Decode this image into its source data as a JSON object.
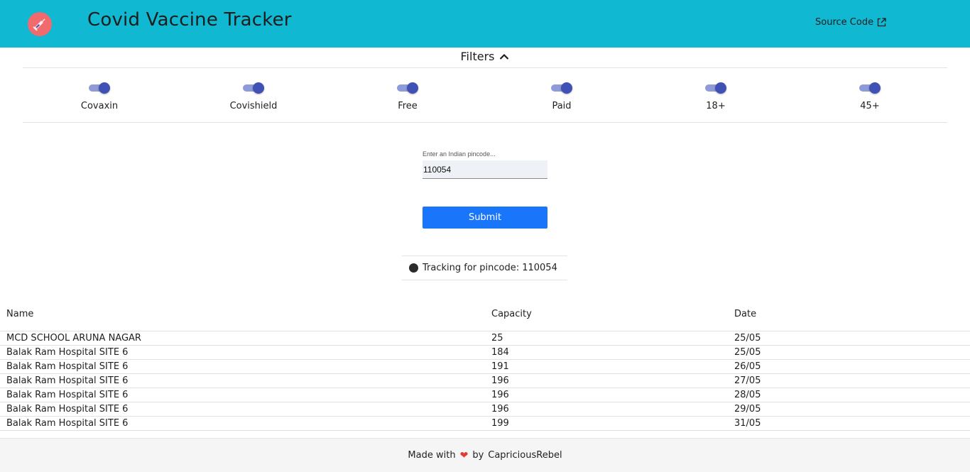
{
  "header": {
    "title": "Covid Vaccine Tracker",
    "logo_icon": "syringe-icon",
    "source_code_label": "Source Code",
    "source_code_icon": "external-link-icon",
    "bg_color": "#10b8d2"
  },
  "filters": {
    "toggle_label": "Filters",
    "toggle_icon": "chevron-up-icon",
    "items": [
      {
        "label": "Covaxin",
        "enabled": true
      },
      {
        "label": "Covishield",
        "enabled": true
      },
      {
        "label": "Free",
        "enabled": true
      },
      {
        "label": "Paid",
        "enabled": true
      },
      {
        "label": "18+",
        "enabled": true
      },
      {
        "label": "45+",
        "enabled": true
      }
    ]
  },
  "search": {
    "placeholder": "Enter an Indian pincode...",
    "value": "110054",
    "submit_label": "Submit"
  },
  "tracking": {
    "text": "Tracking for pincode: 110054"
  },
  "table": {
    "columns": [
      "Name",
      "Capacity",
      "Date"
    ],
    "rows": [
      [
        "MCD SCHOOL ARUNA NAGAR",
        "25",
        "25/05"
      ],
      [
        "Balak Ram Hospital SITE 6",
        "184",
        "25/05"
      ],
      [
        "Balak Ram Hospital SITE 6",
        "191",
        "26/05"
      ],
      [
        "Balak Ram Hospital SITE 6",
        "196",
        "27/05"
      ],
      [
        "Balak Ram Hospital SITE 6",
        "196",
        "28/05"
      ],
      [
        "Balak Ram Hospital SITE 6",
        "196",
        "29/05"
      ],
      [
        "Balak Ram Hospital SITE 6",
        "199",
        "31/05"
      ]
    ]
  },
  "footer": {
    "made_with": "Made with",
    "heart_icon": "heart-icon",
    "by": "by",
    "author": "CapriciousRebel"
  }
}
